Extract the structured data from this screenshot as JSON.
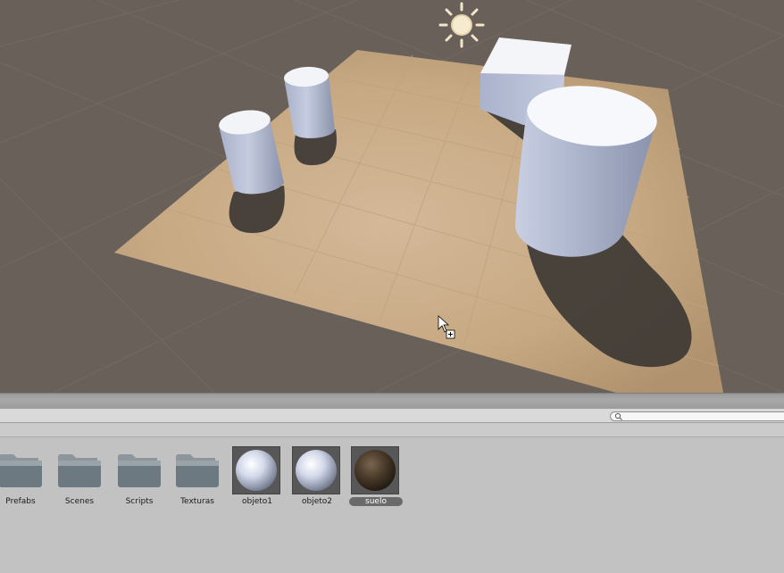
{
  "scene": {
    "colors": {
      "background": "#6a605a",
      "plane": "#cdb08f",
      "primitive": "#b8c0d8",
      "shadow": "#3a3634",
      "sun": "#f3e6c8"
    },
    "light_icon": "sun-icon",
    "cursor_icon": "drag-copy-cursor-icon"
  },
  "project": {
    "search": {
      "placeholder": "",
      "icon": "search-icon"
    },
    "assets": [
      {
        "label": "Prefabs",
        "kind": "folder",
        "icon": "folder-icon"
      },
      {
        "label": "Scenes",
        "kind": "folder",
        "icon": "folder-icon"
      },
      {
        "label": "Scripts",
        "kind": "folder",
        "icon": "folder-icon"
      },
      {
        "label": "Texturas",
        "kind": "folder",
        "icon": "folder-icon"
      },
      {
        "label": "objeto1",
        "kind": "material",
        "icon": "sphere-material-icon",
        "color": "#d7dcee"
      },
      {
        "label": "objeto2",
        "kind": "material",
        "icon": "sphere-material-icon",
        "color": "#d7dcee"
      },
      {
        "label": "suelo",
        "kind": "material",
        "icon": "sphere-material-icon",
        "color": "#4a3a2a",
        "selected": true
      }
    ]
  }
}
